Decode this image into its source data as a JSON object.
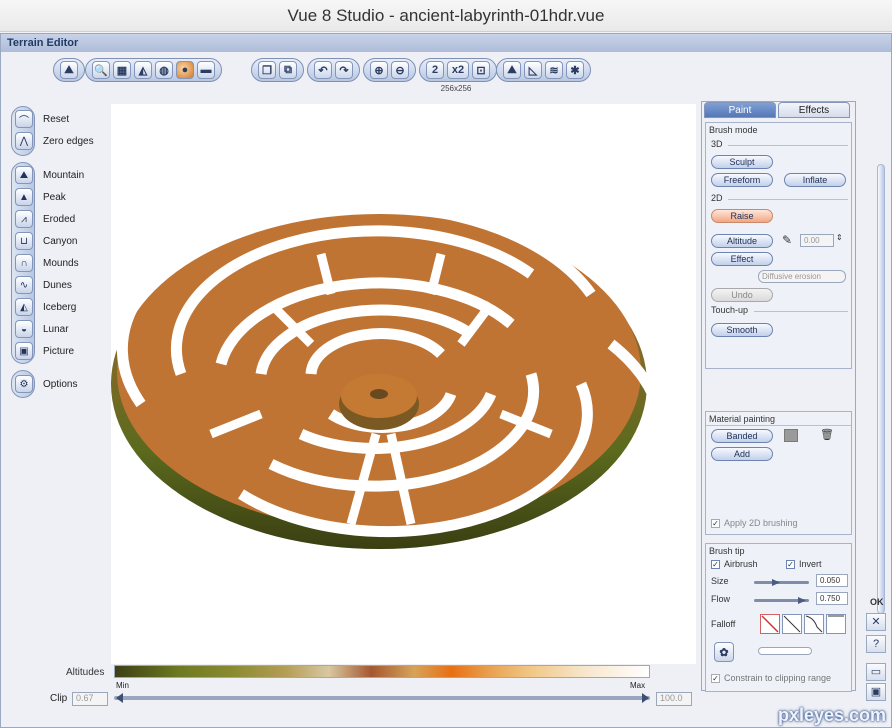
{
  "window": {
    "title": "Vue 8 Studio - ancient-labyrinth-01hdr.vue"
  },
  "editor": {
    "header": "Terrain Editor",
    "resolution": "256x256"
  },
  "toolbar": {
    "zoom_labels": [
      "2",
      "x2"
    ]
  },
  "left_panel": {
    "group1": [
      {
        "label": "Reset",
        "icon": "reset-icon"
      },
      {
        "label": "Zero edges",
        "icon": "zero-edges-icon"
      }
    ],
    "group2": [
      {
        "label": "Mountain",
        "icon": "mountain-icon"
      },
      {
        "label": "Peak",
        "icon": "peak-icon"
      },
      {
        "label": "Eroded",
        "icon": "eroded-icon"
      },
      {
        "label": "Canyon",
        "icon": "canyon-icon"
      },
      {
        "label": "Mounds",
        "icon": "mounds-icon"
      },
      {
        "label": "Dunes",
        "icon": "dunes-icon"
      },
      {
        "label": "Iceberg",
        "icon": "iceberg-icon"
      },
      {
        "label": "Lunar",
        "icon": "lunar-icon"
      },
      {
        "label": "Picture",
        "icon": "picture-icon"
      }
    ],
    "options": {
      "label": "Options",
      "icon": "options-icon"
    }
  },
  "right_panel": {
    "tabs": {
      "paint": "Paint",
      "effects": "Effects"
    },
    "brush_mode": {
      "title": "Brush mode",
      "section_3d": "3D",
      "sculpt": "Sculpt",
      "freeform": "Freeform",
      "inflate": "Inflate",
      "section_2d": "2D",
      "raise": "Raise",
      "altitude": "Altitude",
      "altitude_value": "0.00",
      "effect": "Effect",
      "effect_select": "Diffusive erosion",
      "undo": "Undo",
      "section_touchup": "Touch-up",
      "smooth": "Smooth"
    },
    "material_painting": {
      "title": "Material painting",
      "banded": "Banded",
      "add": "Add",
      "apply_2d": "Apply 2D brushing"
    },
    "brush_tip": {
      "title": "Brush tip",
      "airbrush": "Airbrush",
      "invert": "Invert",
      "size_label": "Size",
      "size_value": "0.050",
      "flow_label": "Flow",
      "flow_value": "0.750",
      "falloff_label": "Falloff",
      "constrain": "Constrain to clipping range"
    }
  },
  "bottom": {
    "altitudes_label": "Altitudes",
    "min": "Min",
    "max": "Max",
    "clip_label": "Clip",
    "clip_low": "0.67",
    "clip_high": "100.0"
  },
  "edge_panel": {
    "ok": "OK",
    "close": "✕",
    "help": "?"
  },
  "watermark": "pxleyes.com"
}
